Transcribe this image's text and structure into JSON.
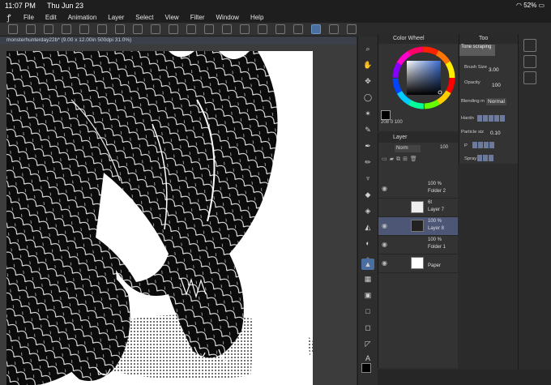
{
  "status": {
    "time": "11:07 PM",
    "date": "Thu Jun 23",
    "battery": "52%"
  },
  "menu": [
    "File",
    "Edit",
    "Animation",
    "Layer",
    "Select",
    "View",
    "Filter",
    "Window",
    "Help"
  ],
  "document": {
    "tab_title": "monsterhunterday22b* (9.00 x 12.00in 500dpi 31.0%)"
  },
  "color_wheel": {
    "title": "Color Wheel",
    "h": "208",
    "s": "0",
    "v": "100"
  },
  "layer_panel": {
    "title": "Layer",
    "blend_mode": "Norm",
    "opacity": "100",
    "layers": [
      {
        "percent": "100 %",
        "name": "Folder 2"
      },
      {
        "percent": "6t",
        "name": "Layer 7"
      },
      {
        "percent": "100 %",
        "name": "Layer 8"
      },
      {
        "percent": "100 %",
        "name": "Folder 1"
      },
      {
        "percent": "",
        "name": "Paper"
      }
    ]
  },
  "tool_property": {
    "tab": "Too",
    "tool_name": "Tone scraping",
    "brush_size_label": "Brush Size",
    "brush_size": "3.00",
    "opacity_label": "Opacity",
    "opacity": "100",
    "blending_label": "Blending m",
    "blending": "Normal",
    "hardness_label": "Hardn",
    "particle_label": "Particle siz",
    "particle_size": "0.10",
    "p_label": "P",
    "spray_label": "Spray"
  }
}
